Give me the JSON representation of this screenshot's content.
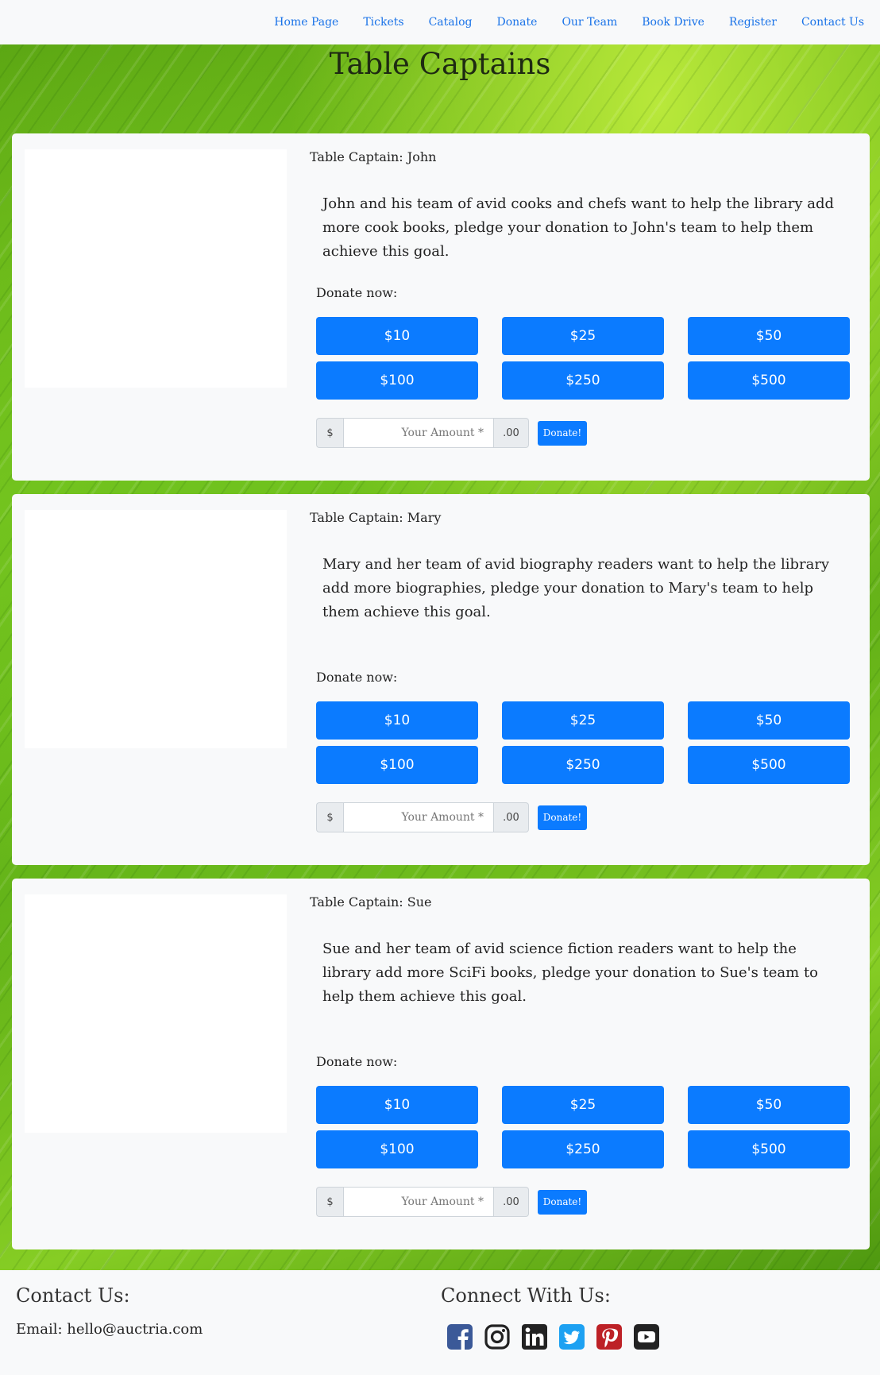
{
  "nav": {
    "items": [
      "Home Page",
      "Tickets",
      "Catalog",
      "Donate",
      "Our Team",
      "Book Drive",
      "Register",
      "Contact Us"
    ]
  },
  "page": {
    "title": "Table Captains"
  },
  "donate_label": "Donate now:",
  "amounts": [
    "$10",
    "$25",
    "$50",
    "$100",
    "$250",
    "$500"
  ],
  "custom": {
    "prefix": "$",
    "placeholder": "Your Amount *",
    "suffix": ".00",
    "button": "Donate!"
  },
  "captains": [
    {
      "name": "Table Captain: John",
      "description": "John and his team of avid cooks and chefs want to help the library add more cook books, pledge your donation to John's team to help them achieve this goal."
    },
    {
      "name": "Table Captain: Mary",
      "description": "Mary and her team of avid biography readers want to help the library add more biographies, pledge your donation to Mary's team to help them achieve this goal."
    },
    {
      "name": "Table Captain: Sue",
      "description": "Sue and her team of avid science fiction readers want to help the library add more SciFi books, pledge your donation to Sue's team to help them achieve this goal."
    }
  ],
  "footer": {
    "contact_heading": "Contact Us:",
    "email": "Email: hello@auctria.com",
    "connect_heading": "Connect With Us:",
    "social": [
      {
        "icon": "facebook-icon",
        "color": "#3b5998"
      },
      {
        "icon": "instagram-icon",
        "color": "#222222"
      },
      {
        "icon": "linkedin-icon",
        "color": "#222222"
      },
      {
        "icon": "twitter-icon",
        "color": "#1da1f2"
      },
      {
        "icon": "pinterest-icon",
        "color": "#bd2126"
      },
      {
        "icon": "youtube-icon",
        "color": "#222222"
      }
    ]
  },
  "colors": {
    "accent": "#0b7bff",
    "nav_link": "#1a73e8",
    "card_bg": "#f8f9fa"
  }
}
